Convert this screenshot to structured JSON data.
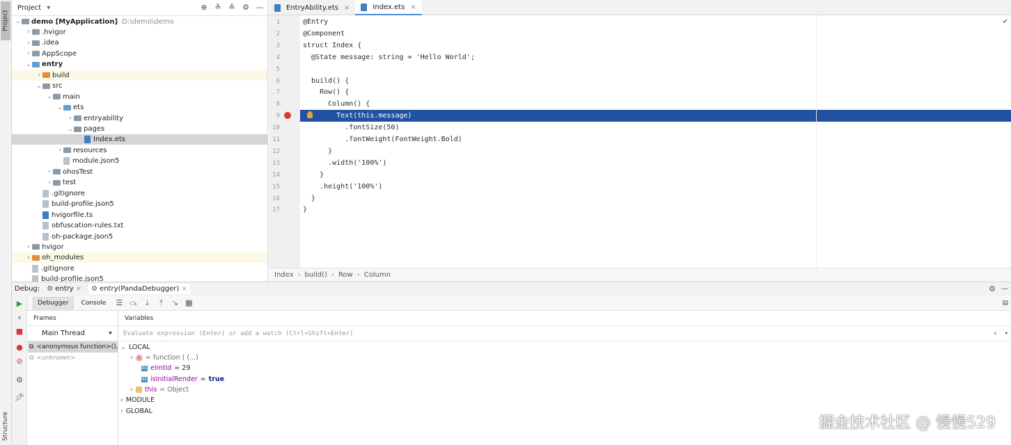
{
  "left_strip": {
    "project_tab": "Project",
    "structure_tab": "Structure"
  },
  "project_panel": {
    "title": "Project",
    "tree": [
      {
        "label": "demo [MyApplication]",
        "extra": "D:\\demo\\demo",
        "depth": 0,
        "expanded": true,
        "icon": "folder"
      },
      {
        "label": ".hvigor",
        "depth": 1,
        "expanded": false,
        "icon": "folder"
      },
      {
        "label": ".idea",
        "depth": 1,
        "expanded": false,
        "icon": "folder"
      },
      {
        "label": "AppScope",
        "depth": 1,
        "expanded": false,
        "icon": "folder"
      },
      {
        "label": "entry",
        "depth": 1,
        "expanded": true,
        "icon": "folder-blue"
      },
      {
        "label": "build",
        "depth": 2,
        "expanded": false,
        "icon": "folder-orange"
      },
      {
        "label": "src",
        "depth": 2,
        "expanded": true,
        "icon": "folder"
      },
      {
        "label": "main",
        "depth": 3,
        "expanded": true,
        "icon": "folder"
      },
      {
        "label": "ets",
        "depth": 4,
        "expanded": true,
        "icon": "folder-blue"
      },
      {
        "label": "entryability",
        "depth": 5,
        "expanded": false,
        "icon": "folder"
      },
      {
        "label": "pages",
        "depth": 5,
        "expanded": true,
        "icon": "folder"
      },
      {
        "label": "Index.ets",
        "depth": 6,
        "icon": "file-ets"
      },
      {
        "label": "resources",
        "depth": 4,
        "expanded": false,
        "icon": "folder"
      },
      {
        "label": "module.json5",
        "depth": 4,
        "icon": "file"
      },
      {
        "label": "ohosTest",
        "depth": 3,
        "expanded": false,
        "icon": "folder"
      },
      {
        "label": "test",
        "depth": 3,
        "expanded": false,
        "icon": "folder"
      },
      {
        "label": ".gitignore",
        "depth": 2,
        "icon": "file"
      },
      {
        "label": "build-profile.json5",
        "depth": 2,
        "icon": "file"
      },
      {
        "label": "hvigorfile.ts",
        "depth": 2,
        "icon": "file-ets"
      },
      {
        "label": "obfuscation-rules.txt",
        "depth": 2,
        "icon": "file"
      },
      {
        "label": "oh-package.json5",
        "depth": 2,
        "icon": "file"
      },
      {
        "label": "hvigor",
        "depth": 1,
        "expanded": false,
        "icon": "folder"
      },
      {
        "label": "oh_modules",
        "depth": 1,
        "expanded": false,
        "icon": "folder-orange"
      },
      {
        "label": ".gitignore",
        "depth": 1,
        "icon": "file"
      },
      {
        "label": "build-profile.json5",
        "depth": 1,
        "icon": "file"
      }
    ]
  },
  "editor": {
    "tabs": [
      {
        "label": "EntryAbility.ets",
        "active": false
      },
      {
        "label": "Index.ets",
        "active": true
      }
    ],
    "lines": [
      "@Entry",
      "@Component",
      "struct Index {",
      "  @State message: string = 'Hello World';",
      "",
      "  build() {",
      "    Row() {",
      "      Column() {",
      "        Text(this.message)",
      "          .fontSize(50)",
      "          .fontWeight(FontWeight.Bold)",
      "      }",
      "      .width('100%')",
      "    }",
      "    .height('100%')",
      "  }",
      "}"
    ],
    "line_numbers": [
      "1",
      "2",
      "3",
      "4",
      "5",
      "6",
      "7",
      "8",
      "9",
      "10",
      "11",
      "12",
      "13",
      "14",
      "15",
      "16",
      "17"
    ],
    "highlighted_line": 9,
    "breadcrumb": [
      "Index",
      "build()",
      "Row",
      "Column"
    ]
  },
  "debug": {
    "label": "Debug:",
    "sessions": [
      {
        "label": "entry"
      },
      {
        "label": "entry(PandaDebugger)"
      }
    ],
    "toolbar": {
      "debugger_tab": "Debugger",
      "console_tab": "Console"
    },
    "frames_title": "Frames",
    "thread": "Main Thread",
    "frames": [
      {
        "label": "<anonymous function>(),"
      },
      {
        "label": "<unknown>"
      }
    ],
    "variables_title": "Variables",
    "watch_placeholder": "Evaluate expression (Enter) or add a watch (Ctrl+Shift+Enter)",
    "variables": [
      {
        "label": "LOCAL",
        "depth": 0,
        "expanded": true
      },
      {
        "name": "",
        "value": "= function ( (...)",
        "depth": 1,
        "expandable": true,
        "icon": "lambda"
      },
      {
        "name": "elmtId",
        "value": "= 29",
        "depth": 1,
        "icon": "01"
      },
      {
        "name": "isInitialRender",
        "value": "= ",
        "value_bold": "true",
        "depth": 1,
        "icon": "01"
      },
      {
        "name": "this",
        "value": "= Object",
        "depth": 1,
        "expandable": true,
        "icon": "obj"
      },
      {
        "label": "MODULE",
        "depth": 0,
        "expanded": false
      },
      {
        "label": "GLOBAL",
        "depth": 0,
        "expanded": false
      }
    ]
  },
  "watermark": "掘金技术社区 @ 慢慢529",
  "colors": {
    "highlight": "#2251a4",
    "accent": "#4a8ae0",
    "keyword": "#0033b3",
    "string": "#067d17"
  }
}
